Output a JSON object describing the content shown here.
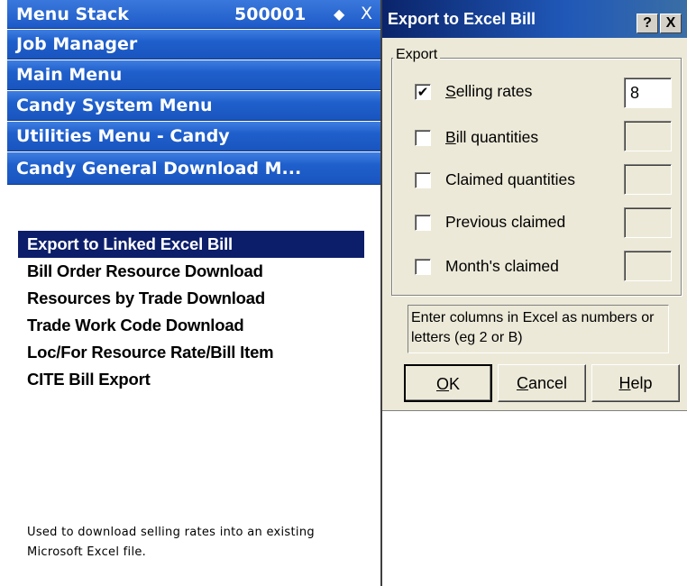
{
  "menu_stack": {
    "title": "Menu Stack",
    "code": "500001",
    "back_icon": "◆",
    "back_icon_name": "back-arrow-icon",
    "close_label": "X",
    "levels": [
      "Job Manager",
      "Main Menu",
      "Candy System Menu",
      "Utilities Menu - Candy",
      "Candy General Download M..."
    ]
  },
  "menu": {
    "items": [
      "Export to Linked Excel Bill",
      "Bill Order Resource Download",
      "Resources by Trade Download",
      "Trade Work Code Download",
      "Loc/For Resource Rate/Bill Item",
      "CITE Bill Export"
    ],
    "selected_index": 0,
    "description": "Used to download selling rates into an existing Microsoft Excel file."
  },
  "dialog": {
    "title": "Export to Excel Bill",
    "help_label": "?",
    "close_label": "X",
    "group_label": "Export",
    "options": [
      {
        "pre": "",
        "ul": "S",
        "post": "elling rates",
        "checked": true,
        "check_mark": "✔",
        "value": "8",
        "enabled": true
      },
      {
        "pre": "",
        "ul": "B",
        "post": "ill quantities",
        "checked": false,
        "check_mark": "",
        "value": "",
        "enabled": false
      },
      {
        "pre": "Claimed quantities",
        "ul": "",
        "post": "",
        "checked": false,
        "check_mark": "",
        "value": "",
        "enabled": false
      },
      {
        "pre": "Previous claimed",
        "ul": "",
        "post": "",
        "checked": false,
        "check_mark": "",
        "value": "",
        "enabled": false
      },
      {
        "pre": "Month's claimed",
        "ul": "",
        "post": "",
        "checked": false,
        "check_mark": "",
        "value": "",
        "enabled": false
      }
    ],
    "hint": "Enter columns in Excel as numbers or letters (eg 2 or B)",
    "buttons": {
      "ok": {
        "ul": "O",
        "rest": "K"
      },
      "cancel": {
        "ul": "C",
        "rest": "ancel"
      },
      "help": {
        "ul": "H",
        "rest": "elp"
      }
    }
  },
  "colors": {
    "stack_bar": "#1f5fcc",
    "selected_bg": "#0c1e6a",
    "dialog_title_start": "#0a246a",
    "dialog_face": "#ece9d8"
  }
}
